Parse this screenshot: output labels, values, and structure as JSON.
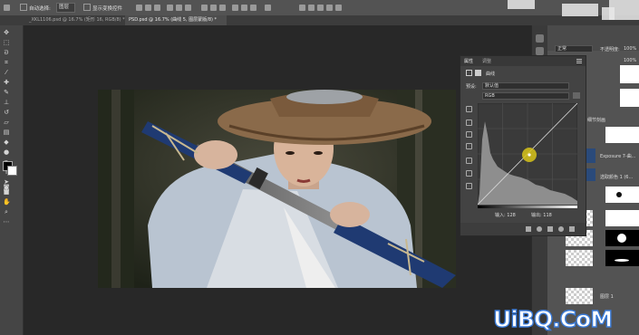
{
  "options_bar": {
    "auto_select_label": "自动选择:",
    "auto_select_value": "图层",
    "show_transform_label": "显示变换控件"
  },
  "tabs": [
    {
      "label": "_XKL1106.psd @ 16.7% (矩形 16, RGB/8) *",
      "active": false
    },
    {
      "label": "PSD.psd @ 16.7% (曲线 5, 图层蒙版/8) *",
      "active": true
    }
  ],
  "properties_panel": {
    "tab_properties": "属性",
    "tab_adjustments": "调整",
    "type_label": "曲线",
    "preset_label": "预设:",
    "preset_value": "默认值",
    "channel_value": "RGB",
    "input_label": "输入: 128",
    "output_label": "输出: 118"
  },
  "layers_panel": {
    "blend_mode": "正常",
    "opacity_label": "不透明度:",
    "opacity_value": "100%",
    "fill_value": "100%",
    "layer_names": [
      "细节刻画",
      "Exposure 7-曲...",
      "选取颜色 1 (6...",
      "图层 1"
    ]
  },
  "watermark": "UiBQ.CoM",
  "colors": {
    "accent_blue": "#3b7bd8",
    "panel_bg": "#535353",
    "workspace_bg": "#282828"
  },
  "icons": [
    "move-icon",
    "marquee-icon",
    "lasso-icon",
    "crop-icon",
    "eyedropper-icon",
    "healing-icon",
    "brush-icon",
    "stamp-icon",
    "history-brush-icon",
    "eraser-icon",
    "gradient-icon",
    "blur-icon",
    "dodge-icon",
    "pen-icon",
    "type-icon",
    "path-select-icon",
    "shape-icon",
    "hand-icon",
    "zoom-icon",
    "swap-colors-icon",
    "quick-mask-icon",
    "screen-mode-icon"
  ]
}
